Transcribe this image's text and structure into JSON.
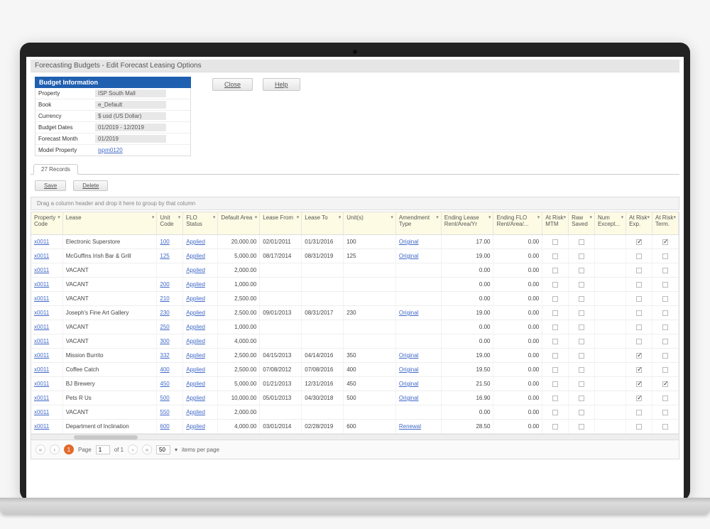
{
  "page_title": "Forecasting Budgets - Edit Forecast Leasing Options",
  "panel": {
    "header": "Budget Information",
    "rows": [
      {
        "label": "Property",
        "value": "ISP South Mall"
      },
      {
        "label": "Book",
        "value": "e_Default"
      },
      {
        "label": "Currency",
        "value": "$ usd (US Dollar)"
      },
      {
        "label": "Budget Dates",
        "value": "01/2019 - 12/2019"
      },
      {
        "label": "Forecast Month",
        "value": "01/2019"
      },
      {
        "label": "Model Property",
        "value": "ispm0120"
      }
    ]
  },
  "top_buttons": {
    "close": "Close",
    "help": "Help"
  },
  "tab_label": "27 Records",
  "grid_buttons": {
    "save": "Save",
    "delete": "Delete"
  },
  "group_hint": "Drag a column header and drop it here to group by that column",
  "columns": [
    "Property Code",
    "Lease",
    "Unit Code",
    "FLO Status",
    "Default Area",
    "Lease From",
    "Lease To",
    "Unit(s)",
    "Amendment Type",
    "Ending Lease Rent/Area/Yr",
    "Ending FLO Rent/Area/...",
    "At Risk MTM",
    "Raw Saved",
    "Num Except...",
    "At Risk Exp.",
    "At Risk Term."
  ],
  "rows": [
    {
      "pc": "x0011",
      "lease": "Electronic Superstore",
      "uc": "100",
      "flo": "Applied",
      "area": "20,000.00",
      "from": "02/01/2011",
      "to": "01/31/2016",
      "units": "100",
      "amend": "Original",
      "endLease": "17.00",
      "endFlo": "0.00",
      "mtm": false,
      "saved": false,
      "except": "",
      "riskExp": true,
      "riskTerm": true
    },
    {
      "pc": "x0011",
      "lease": "McGuffins Irish Bar & Grill",
      "uc": "125",
      "flo": "Applied",
      "area": "5,000.00",
      "from": "08/17/2014",
      "to": "08/31/2019",
      "units": "125",
      "amend": "Original",
      "endLease": "19.00",
      "endFlo": "0.00",
      "mtm": false,
      "saved": false,
      "except": "",
      "riskExp": false,
      "riskTerm": false
    },
    {
      "pc": "x0011",
      "lease": "VACANT",
      "uc": "",
      "flo": "Applied",
      "area": "2,000.00",
      "from": "",
      "to": "",
      "units": "",
      "amend": "",
      "endLease": "0.00",
      "endFlo": "0.00",
      "mtm": false,
      "saved": false,
      "except": "",
      "riskExp": false,
      "riskTerm": false
    },
    {
      "pc": "x0011",
      "lease": "VACANT",
      "uc": "200",
      "flo": "Applied",
      "area": "1,000.00",
      "from": "",
      "to": "",
      "units": "",
      "amend": "",
      "endLease": "0.00",
      "endFlo": "0.00",
      "mtm": false,
      "saved": false,
      "except": "",
      "riskExp": false,
      "riskTerm": false
    },
    {
      "pc": "x0011",
      "lease": "VACANT",
      "uc": "210",
      "flo": "Applied",
      "area": "2,500.00",
      "from": "",
      "to": "",
      "units": "",
      "amend": "",
      "endLease": "0.00",
      "endFlo": "0.00",
      "mtm": false,
      "saved": false,
      "except": "",
      "riskExp": false,
      "riskTerm": false
    },
    {
      "pc": "x0011",
      "lease": "Joseph's Fine Art Gallery",
      "uc": "230",
      "flo": "Applied",
      "area": "2,500.00",
      "from": "09/01/2013",
      "to": "08/31/2017",
      "units": "230",
      "amend": "Original",
      "endLease": "19.00",
      "endFlo": "0.00",
      "mtm": false,
      "saved": false,
      "except": "",
      "riskExp": false,
      "riskTerm": false
    },
    {
      "pc": "x0011",
      "lease": "VACANT",
      "uc": "250",
      "flo": "Applied",
      "area": "1,000.00",
      "from": "",
      "to": "",
      "units": "",
      "amend": "",
      "endLease": "0.00",
      "endFlo": "0.00",
      "mtm": false,
      "saved": false,
      "except": "",
      "riskExp": false,
      "riskTerm": false
    },
    {
      "pc": "x0011",
      "lease": "VACANT",
      "uc": "300",
      "flo": "Applied",
      "area": "4,000.00",
      "from": "",
      "to": "",
      "units": "",
      "amend": "",
      "endLease": "0.00",
      "endFlo": "0.00",
      "mtm": false,
      "saved": false,
      "except": "",
      "riskExp": false,
      "riskTerm": false
    },
    {
      "pc": "x0011",
      "lease": "Mission Burrito",
      "uc": "332",
      "flo": "Applied",
      "area": "2,500.00",
      "from": "04/15/2013",
      "to": "04/14/2016",
      "units": "350",
      "amend": "Original",
      "endLease": "19.00",
      "endFlo": "0.00",
      "mtm": false,
      "saved": false,
      "except": "",
      "riskExp": true,
      "riskTerm": false
    },
    {
      "pc": "x0011",
      "lease": "Coffee Catch",
      "uc": "400",
      "flo": "Applied",
      "area": "2,500.00",
      "from": "07/08/2012",
      "to": "07/08/2016",
      "units": "400",
      "amend": "Original",
      "endLease": "19.50",
      "endFlo": "0.00",
      "mtm": false,
      "saved": false,
      "except": "",
      "riskExp": true,
      "riskTerm": false
    },
    {
      "pc": "x0011",
      "lease": "BJ Brewery",
      "uc": "450",
      "flo": "Applied",
      "area": "5,000.00",
      "from": "01/21/2013",
      "to": "12/31/2016",
      "units": "450",
      "amend": "Original",
      "endLease": "21.50",
      "endFlo": "0.00",
      "mtm": false,
      "saved": false,
      "except": "",
      "riskExp": true,
      "riskTerm": true
    },
    {
      "pc": "x0011",
      "lease": "Pets R Us",
      "uc": "500",
      "flo": "Applied",
      "area": "10,000.00",
      "from": "05/01/2013",
      "to": "04/30/2018",
      "units": "500",
      "amend": "Original",
      "endLease": "16.90",
      "endFlo": "0.00",
      "mtm": false,
      "saved": false,
      "except": "",
      "riskExp": true,
      "riskTerm": false
    },
    {
      "pc": "x0011",
      "lease": "VACANT",
      "uc": "550",
      "flo": "Applied",
      "area": "2,000.00",
      "from": "",
      "to": "",
      "units": "",
      "amend": "",
      "endLease": "0.00",
      "endFlo": "0.00",
      "mtm": false,
      "saved": false,
      "except": "",
      "riskExp": false,
      "riskTerm": false
    },
    {
      "pc": "x0011",
      "lease": "Department of Inclination",
      "uc": "600",
      "flo": "Applied",
      "area": "4,000.00",
      "from": "03/01/2014",
      "to": "02/28/2019",
      "units": "600",
      "amend": "Renewal",
      "endLease": "28.50",
      "endFlo": "0.00",
      "mtm": false,
      "saved": false,
      "except": "",
      "riskExp": false,
      "riskTerm": false
    }
  ],
  "pager": {
    "page": "1",
    "of_label": "of 1",
    "per_page": "50",
    "per_page_label": "items per page",
    "page_label": "Page"
  }
}
